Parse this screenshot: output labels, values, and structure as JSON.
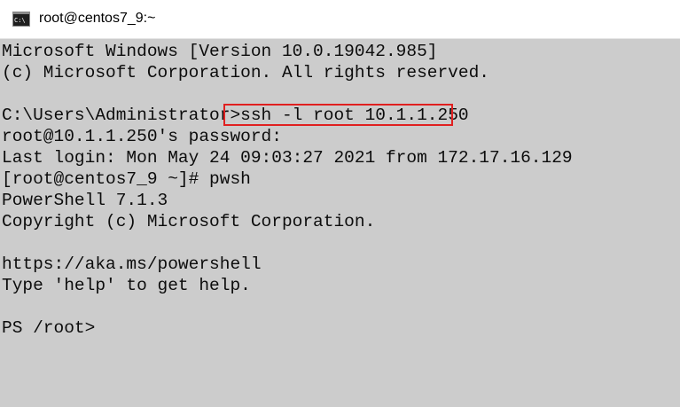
{
  "window": {
    "title": "root@centos7_9:~",
    "icon": "cmd-icon"
  },
  "console": {
    "lines": [
      "Microsoft Windows [Version 10.0.19042.985]",
      "(c) Microsoft Corporation. All rights reserved.",
      "",
      "C:\\Users\\Administrator>",
      "root@10.1.1.250's password:",
      "Last login: Mon May 24 09:03:27 2021 from 172.17.16.129",
      "[root@centos7_9 ~]# pwsh",
      "PowerShell 7.1.3",
      "Copyright (c) Microsoft Corporation.",
      "",
      "https://aka.ms/powershell",
      "Type 'help' to get help.",
      "",
      "PS /root>"
    ],
    "highlighted_command": "ssh -l root 10.1.1.250"
  },
  "colors": {
    "console_bg": "#cccccc",
    "console_fg": "#0c0c0c",
    "highlight_border": "#e02020",
    "titlebar_bg": "#ffffff"
  }
}
